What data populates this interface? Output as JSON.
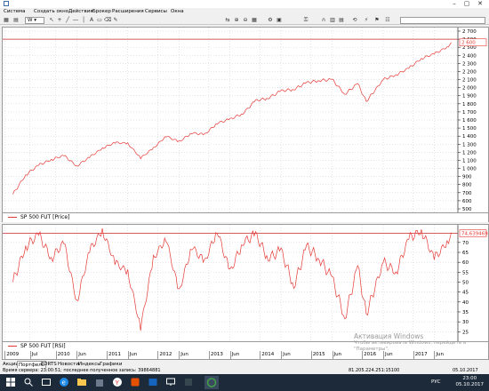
{
  "menu": [
    "Система",
    "Создать окно",
    "Действия",
    "Брокер",
    "Расширения",
    "Сервисы",
    "Окна"
  ],
  "toolbar": {
    "timeframe": "W",
    "symbol": ""
  },
  "price_pane": {
    "legend": "SP 500 FUT [Price]",
    "current_value": "2 600",
    "y_ticks": [
      "2 700",
      "2 600",
      "2 500",
      "2 400",
      "2 300",
      "2 200",
      "2 100",
      "2 000",
      "1 900",
      "1 800",
      "1 700",
      "1 600",
      "1 500",
      "1 400",
      "1 300",
      "1 200",
      "1 100",
      "1 000",
      "900",
      "800",
      "700",
      "600",
      "500"
    ]
  },
  "rsi_pane": {
    "legend": "SP 500 FUT [RSI]",
    "current_value": "74,639469",
    "y_ticks": [
      "70",
      "65",
      "60",
      "55",
      "50",
      "45",
      "40",
      "35",
      "30",
      "25"
    ]
  },
  "x_axis": [
    "2009",
    "Jul",
    "2010",
    "Jun",
    "2011",
    "Jun",
    "2012",
    "Jun",
    "2013",
    "Jun",
    "2014",
    "Jun",
    "2015",
    "Jun",
    "2016",
    "Jun",
    "2017",
    "Jun"
  ],
  "watermark": {
    "line1": "Активация Windows",
    "line2": "Чтобы активировать Windows, перейдите в",
    "line3": "\"Параметры\"."
  },
  "tabs": [
    "Акции",
    "Портфель",
    "FORTS",
    "Новости",
    "Индексы",
    "Графики"
  ],
  "status": {
    "server_time": "Время сервера: 23:00:51; последнее полученное запись: 39864881",
    "connection": "81.205.224.251:15100",
    "date_right": "05.10.2017"
  },
  "taskbar": {
    "lang": "РУС",
    "time": "23:00",
    "date": "05.10.2017"
  },
  "colors": {
    "series": "#e53935",
    "level_line": "#c62828",
    "grid": "#c8c8c8"
  },
  "chart_data": [
    {
      "type": "line",
      "title": "",
      "series": [
        {
          "name": "SP 500 FUT [Price]",
          "x": [
            "2009-03",
            "2009-06",
            "2009-09",
            "2009-12",
            "2010-03",
            "2010-06",
            "2010-09",
            "2010-12",
            "2011-03",
            "2011-06",
            "2011-09",
            "2011-12",
            "2012-03",
            "2012-06",
            "2012-09",
            "2012-12",
            "2013-03",
            "2013-06",
            "2013-09",
            "2013-12",
            "2014-03",
            "2014-06",
            "2014-09",
            "2014-12",
            "2015-03",
            "2015-06",
            "2015-09",
            "2015-12",
            "2016-02",
            "2016-06",
            "2016-09",
            "2016-12",
            "2017-03",
            "2017-06",
            "2017-09",
            "2017-10"
          ],
          "values": [
            680,
            920,
            1040,
            1110,
            1160,
            1030,
            1140,
            1250,
            1320,
            1310,
            1130,
            1250,
            1400,
            1330,
            1440,
            1420,
            1560,
            1610,
            1680,
            1840,
            1870,
            1960,
            1980,
            2060,
            2090,
            2100,
            1920,
            2050,
            1830,
            2100,
            2160,
            2240,
            2360,
            2420,
            2500,
            2560
          ]
        }
      ],
      "ylim": [
        500,
        2700
      ]
    },
    {
      "type": "line",
      "title": "",
      "series": [
        {
          "name": "SP 500 FUT [RSI]",
          "x": [
            "2009-03",
            "2009-06",
            "2009-09",
            "2009-12",
            "2010-03",
            "2010-06",
            "2010-09",
            "2010-12",
            "2011-03",
            "2011-06",
            "2011-09",
            "2011-12",
            "2012-03",
            "2012-06",
            "2012-09",
            "2012-12",
            "2013-03",
            "2013-06",
            "2013-09",
            "2013-12",
            "2014-03",
            "2014-06",
            "2014-09",
            "2014-12",
            "2015-03",
            "2015-06",
            "2015-09",
            "2015-12",
            "2016-02",
            "2016-06",
            "2016-09",
            "2016-12",
            "2017-03",
            "2017-06",
            "2017-09",
            "2017-10"
          ],
          "values": [
            50,
            68,
            74,
            62,
            70,
            40,
            66,
            76,
            60,
            55,
            27,
            62,
            72,
            45,
            68,
            60,
            76,
            55,
            70,
            74,
            62,
            66,
            48,
            68,
            62,
            52,
            32,
            58,
            34,
            60,
            55,
            72,
            76,
            62,
            70,
            75
          ]
        }
      ],
      "ylim": [
        22,
        78
      ],
      "level": 74.639469
    }
  ]
}
